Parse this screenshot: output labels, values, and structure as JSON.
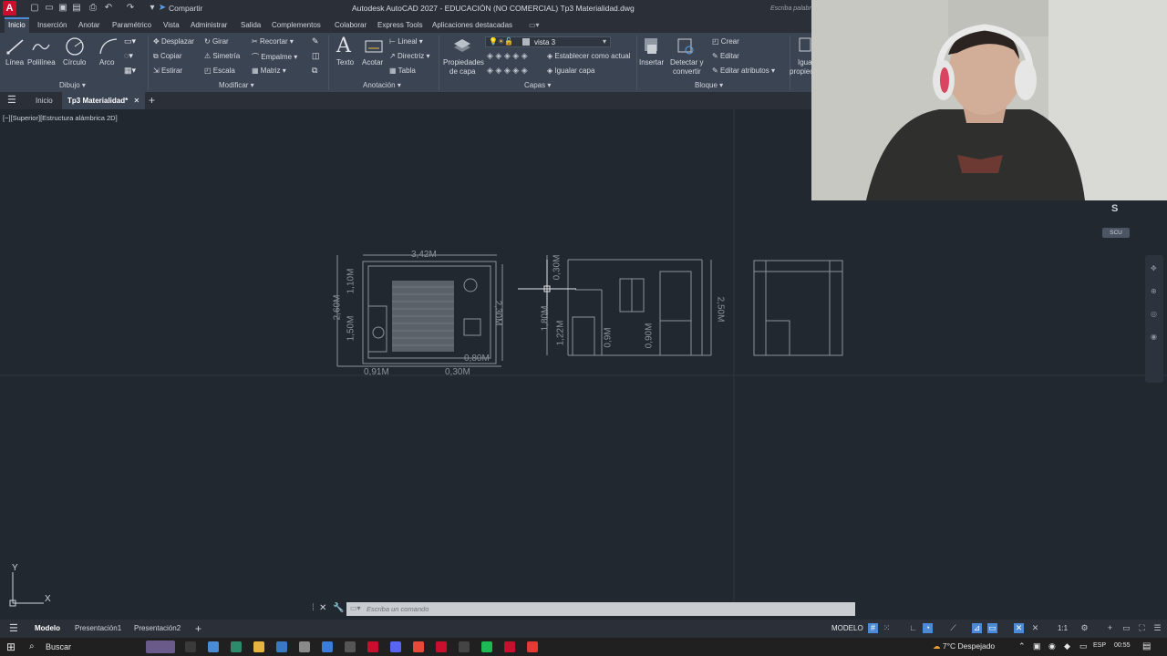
{
  "titlebar": {
    "app_logo": "A",
    "share_label": "Compartir",
    "title": "Autodesk AutoCAD 2027 - EDUCACIÓN (NO COMERCIAL)   Tp3 Materialidad.dwg",
    "search_placeholder": "Escriba palabr"
  },
  "menu_tabs": [
    "Inicio",
    "Inserción",
    "Anotar",
    "Paramétrico",
    "Vista",
    "Administrar",
    "Salida",
    "Complementos",
    "Colaborar",
    "Express Tools",
    "Aplicaciones destacadas"
  ],
  "ribbon": {
    "dibujo": {
      "title": "Dibujo",
      "tools": [
        "Línea",
        "Polilínea",
        "Círculo",
        "Arco"
      ]
    },
    "modificar": {
      "title": "Modificar",
      "tools": [
        "Desplazar",
        "Girar",
        "Recortar",
        "Copiar",
        "Simetría",
        "Empalme",
        "Estirar",
        "Escala",
        "Matriz"
      ]
    },
    "anotacion": {
      "title": "Anotación",
      "big": [
        "Texto",
        "Acotar"
      ],
      "tools": [
        "Lineal",
        "Directriz",
        "Tabla"
      ]
    },
    "capas": {
      "title": "Capas",
      "layer_props_line1": "Propiedades",
      "layer_props_line2": "de capa",
      "current_layer": "vista 3",
      "set_current": "Establecer como actual",
      "match_layer": "Igualar capa"
    },
    "bloque": {
      "title": "Bloque",
      "insert": "Insertar",
      "detect_line1": "Detectar y",
      "detect_line2": "convertir",
      "tools": [
        "Crear",
        "Editar",
        "Editar atributos"
      ]
    },
    "propiedades": {
      "line1": "Igua",
      "line2": "propiec"
    }
  },
  "file_tabs": [
    "Inicio",
    "Tp3 Materialidad*"
  ],
  "viewport_label": "[−][Superior][Estructura alámbrica 2D]",
  "drawing": {
    "dims_view1": [
      "3,42M",
      "1,10M",
      "2,60M",
      "1,50M",
      "2,30M",
      "0,80M",
      "0,91M",
      "0,30M"
    ],
    "dims_view2": [
      "0,30M",
      "1,80M",
      "1,22M",
      "0,9M",
      "0,90M",
      "2,50M"
    ]
  },
  "navigation": {
    "compass_letter": "S",
    "ucs_label": "SCU"
  },
  "axes": {
    "x": "X",
    "y": "Y"
  },
  "command_line": {
    "placeholder": "Escriba un comando"
  },
  "status_tabs": [
    "Modelo",
    "Presentación1",
    "Presentación2"
  ],
  "status_right": {
    "mode": "MODELO",
    "scale": "1:1"
  },
  "taskbar": {
    "search": "Buscar",
    "weather": "7°C  Despejado",
    "language": "ESP",
    "time": "00:55"
  },
  "colors": {
    "canvas": "#212830",
    "ribbon": "#3b4453",
    "accent": "#4d8ad6",
    "autocad_red": "#c8102e"
  }
}
